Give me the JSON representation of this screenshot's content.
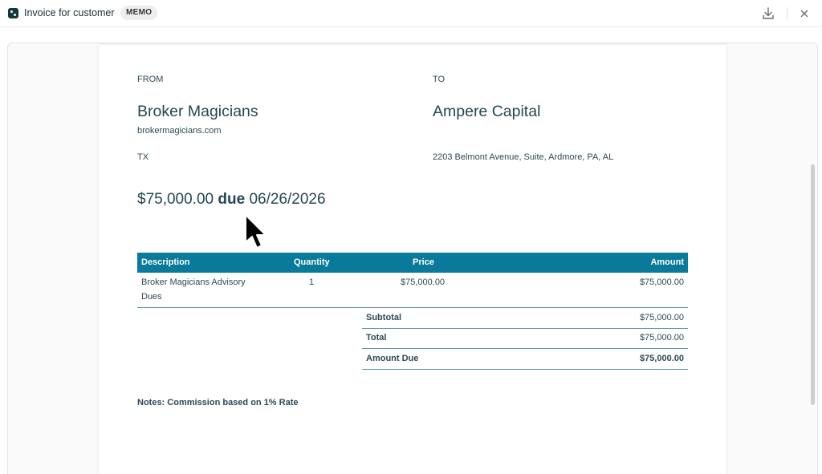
{
  "window": {
    "title": "Invoice for customer",
    "badge": "MEMO",
    "download_icon": "download-icon",
    "close_icon": "close-icon"
  },
  "invoice": {
    "from_label": "FROM",
    "to_label": "TO",
    "from_name": "Broker Magicians",
    "from_website": "brokermagicians.com",
    "from_state": "TX",
    "to_name": "Ampere Capital",
    "to_address": "2203 Belmont Avenue, Suite, Ardmore, PA, AL",
    "amount": "$75,000.00",
    "due_word": "due",
    "due_date": "06/26/2026",
    "table": {
      "headers": {
        "description": "Description",
        "quantity": "Quantity",
        "price": "Price",
        "amount": "Amount"
      },
      "rows": [
        {
          "description_line1": "Broker Magicians Advisory",
          "description_line2": "Dues",
          "quantity": "1",
          "price": "$75,000.00",
          "amount": "$75,000.00"
        }
      ]
    },
    "totals": {
      "subtotal_label": "Subtotal",
      "subtotal_value": "$75,000.00",
      "total_label": "Total",
      "total_value": "$75,000.00",
      "amount_due_label": "Amount Due",
      "amount_due_value": "$75,000.00"
    },
    "notes": "Notes: Commission based on 1% Rate"
  },
  "colors": {
    "table_header": "#0a7a9b",
    "text": "#2d4a55",
    "app_icon": "#0f3a36"
  }
}
